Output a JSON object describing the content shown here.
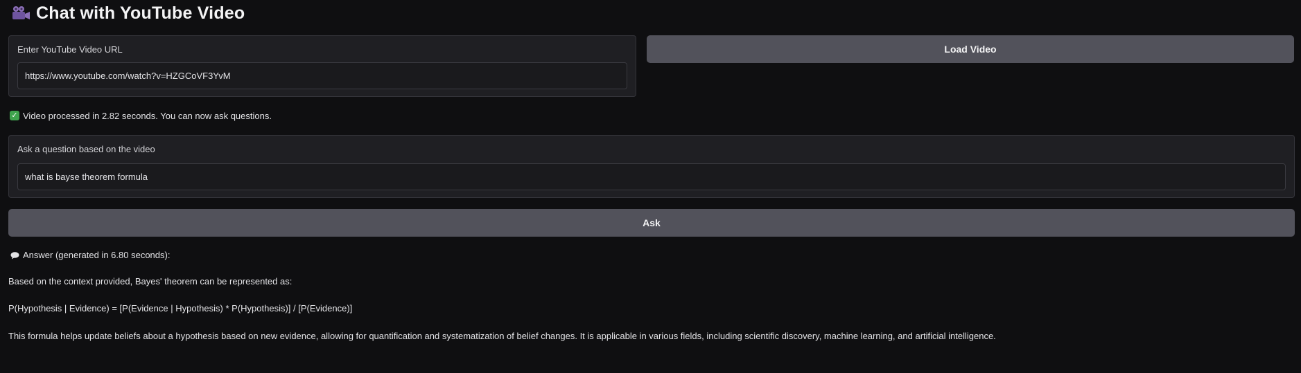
{
  "app": {
    "title": "Chat with YouTube Video",
    "title_icon": "movie-camera-icon"
  },
  "url_panel": {
    "label": "Enter YouTube Video URL",
    "value": "https://www.youtube.com/watch?v=HZGCoVF3YvM",
    "placeholder": ""
  },
  "load_button": {
    "label": "Load Video"
  },
  "status": {
    "icon": "check-mark-icon",
    "text": "Video processed in 2.82 seconds. You can now ask questions."
  },
  "question_panel": {
    "label": "Ask a question based on the video",
    "value": "what is bayse theorem formula",
    "placeholder": ""
  },
  "ask_button": {
    "label": "Ask"
  },
  "answer": {
    "icon": "speech-bubble-icon",
    "header": "Answer (generated in 6.80 seconds):",
    "paragraphs": [
      "Based on the context provided, Bayes' theorem can be represented as:",
      "P(Hypothesis | Evidence) = [P(Evidence | Hypothesis) * P(Hypothesis)] / [P(Evidence)]",
      "This formula helps update beliefs about a hypothesis based on new evidence, allowing for quantification and systematization of belief changes. It is applicable in various fields, including scientific discovery, machine learning, and artificial intelligence."
    ]
  },
  "colors": {
    "background": "#0f0f11",
    "panel": "#1f1f23",
    "button": "#52525b",
    "status_check": "#3fa34d"
  }
}
